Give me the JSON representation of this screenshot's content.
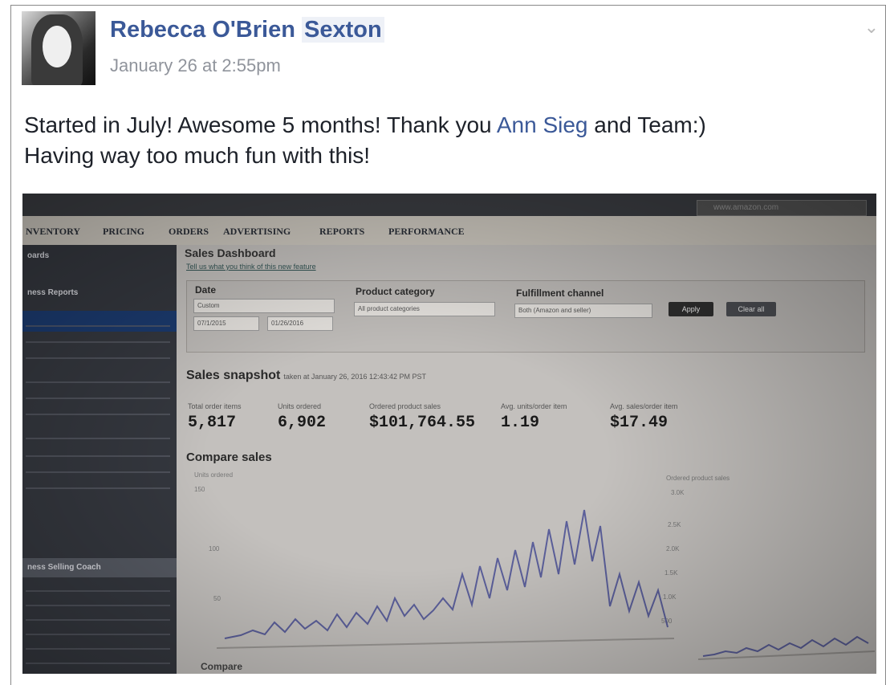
{
  "post": {
    "author": "Rebecca O'Brien",
    "author_highlight": "Sexton",
    "timestamp": "January 26 at 2:55pm",
    "text_part1": "Started in July! Awesome 5 months! Thank you ",
    "mention": "Ann Sieg",
    "text_part2": " and Team:)",
    "text_line2": "Having way too much fun with this!"
  },
  "photo": {
    "url_bar": "www.amazon.com",
    "nav": [
      "NVENTORY",
      "PRICING",
      "ORDERS",
      "ADVERTISING",
      "REPORTS",
      "PERFORMANCE"
    ],
    "sidebar": {
      "heading1": "oards",
      "heading2": "ness Reports",
      "coach": "ness Selling Coach"
    },
    "dashboard_title": "Sales Dashboard",
    "feedback_link": "Tell us what you think of this new feature",
    "filters": {
      "date_label": "Date",
      "date_value": "Custom",
      "date_from": "07/1/2015",
      "date_to": "01/26/2016",
      "category_label": "Product category",
      "category_value": "All product categories",
      "channel_label": "Fulfillment channel",
      "channel_value": "Both (Amazon and seller)",
      "apply_label": "Apply",
      "clear_label": "Clear all"
    },
    "snapshot": {
      "title": "Sales snapshot",
      "taken": "taken at January 26, 2016 12:43:42 PM PST",
      "metrics": [
        {
          "label": "Total order items",
          "value": "5,817"
        },
        {
          "label": "Units ordered",
          "value": "6,902"
        },
        {
          "label": "Ordered product sales",
          "value": "$101,764.55"
        },
        {
          "label": "Avg. units/order item",
          "value": "1.19"
        },
        {
          "label": "Avg. sales/order item",
          "value": "$17.49"
        }
      ]
    },
    "compare": {
      "title": "Compare sales",
      "left_axis": "Units ordered",
      "left_ticks": [
        "150",
        "100",
        "50"
      ],
      "right_axis": "Ordered product sales",
      "right_ticks": [
        "3.0K",
        "2.5K",
        "2.0K",
        "1.5K",
        "1.0K",
        "500"
      ],
      "footer": "Compare"
    }
  }
}
